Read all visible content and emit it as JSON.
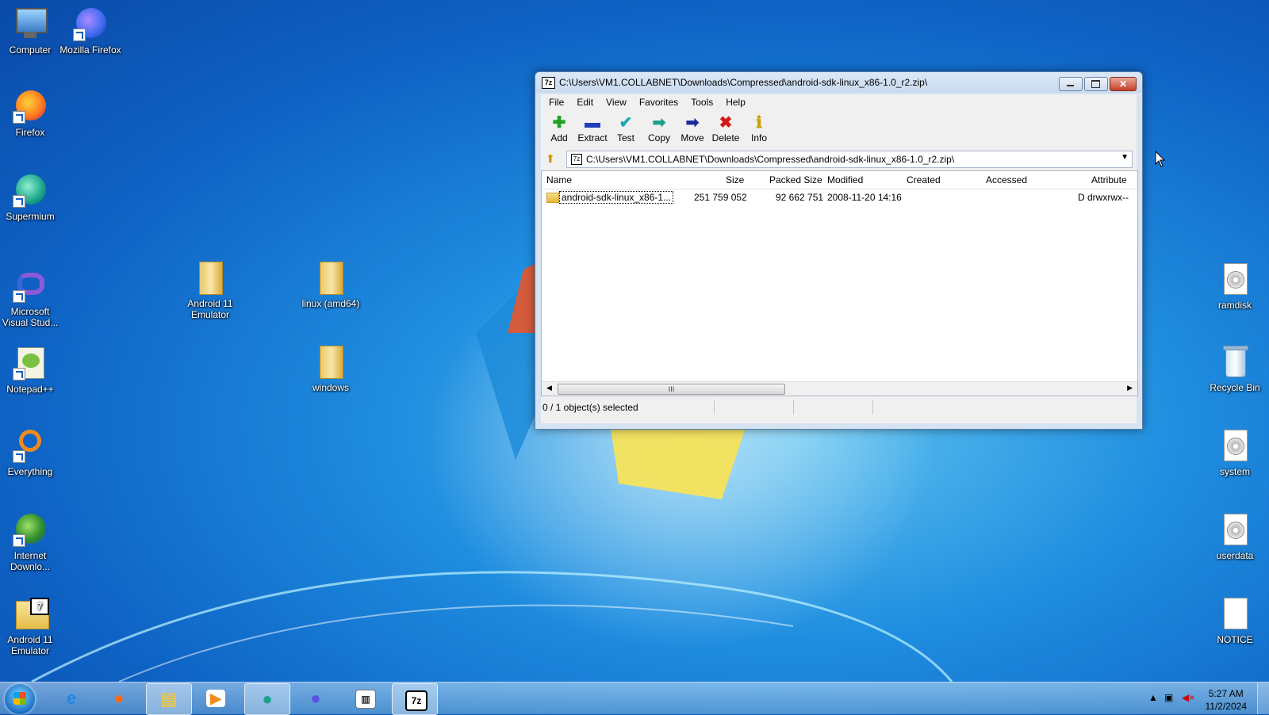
{
  "desktop": {
    "left_icons": [
      {
        "label": "Computer",
        "icon": "computer-icon"
      },
      {
        "label": "Mozilla Firefox",
        "icon": "firefox-icon"
      },
      {
        "label": "Firefox",
        "icon": "firefox-icon"
      },
      {
        "label": "Supermium",
        "icon": "supermium-icon"
      },
      {
        "label": "Microsoft Visual Stud...",
        "icon": "visual-studio-icon"
      },
      {
        "label": "Notepad++",
        "icon": "notepadpp-icon"
      },
      {
        "label": "Everything",
        "icon": "everything-icon"
      },
      {
        "label": "Internet Downlo...",
        "icon": "idm-icon"
      },
      {
        "label": "Android 11 Emulator",
        "icon": "7zip-archive-icon"
      }
    ],
    "mid_icons": [
      {
        "label": "Android 11 Emulator",
        "icon": "folder-icon"
      },
      {
        "label": "linux (amd64)",
        "icon": "folder-icon"
      },
      {
        "label": "windows",
        "icon": "folder-icon"
      }
    ],
    "right_icons": [
      {
        "label": "ramdisk",
        "icon": "disk-image-icon"
      },
      {
        "label": "Recycle Bin",
        "icon": "recycle-bin-icon"
      },
      {
        "label": "system",
        "icon": "disk-image-icon"
      },
      {
        "label": "userdata",
        "icon": "disk-image-icon"
      },
      {
        "label": "NOTICE",
        "icon": "text-file-icon"
      }
    ]
  },
  "window": {
    "title": "C:\\Users\\VM1.COLLABNET\\Downloads\\Compressed\\android-sdk-linux_x86-1.0_r2.zip\\",
    "app_icon": "7z",
    "close_glyph": "✕",
    "menu": [
      "File",
      "Edit",
      "View",
      "Favorites",
      "Tools",
      "Help"
    ],
    "toolbar": [
      {
        "label": "Add",
        "icon": "add-icon",
        "glyph": "✚",
        "color": "#1fa11f"
      },
      {
        "label": "Extract",
        "icon": "extract-icon",
        "glyph": "▬",
        "color": "#1f3fbf"
      },
      {
        "label": "Test",
        "icon": "test-icon",
        "glyph": "✔",
        "color": "#17a8b8"
      },
      {
        "label": "Copy",
        "icon": "copy-icon",
        "glyph": "➡",
        "color": "#17a088"
      },
      {
        "label": "Move",
        "icon": "move-icon",
        "glyph": "➡",
        "color": "#1a2a9a"
      },
      {
        "label": "Delete",
        "icon": "delete-icon",
        "glyph": "✖",
        "color": "#d01a1a"
      },
      {
        "label": "Info",
        "icon": "info-icon",
        "glyph": "ℹ",
        "color": "#c8a000"
      }
    ],
    "address": "C:\\Users\\VM1.COLLABNET\\Downloads\\Compressed\\android-sdk-linux_x86-1.0_r2.zip\\",
    "columns": [
      "Name",
      "Size",
      "Packed Size",
      "Modified",
      "Created",
      "Accessed",
      "Attribute"
    ],
    "rows": [
      {
        "name": "android-sdk-linux_x86-1...",
        "size": "251 759 052",
        "packed": "92 662 751",
        "modified": "2008-11-20 14:16",
        "created": "",
        "accessed": "",
        "attr": "D drwxrwx--"
      }
    ],
    "scroll_thumb": "III",
    "status": "0 / 1 object(s) selected"
  },
  "taskbar": {
    "apps": [
      {
        "name": "ie-icon",
        "glyph": "e",
        "color": "#1e88e5"
      },
      {
        "name": "firefox-icon",
        "glyph": "●",
        "color": "#ff6a13"
      },
      {
        "name": "explorer-icon",
        "glyph": "▤",
        "color": "#e8c64a"
      },
      {
        "name": "media-player-icon",
        "glyph": "▶",
        "color": "#f28c1c"
      },
      {
        "name": "supermium-icon",
        "glyph": "●",
        "color": "#18a38a"
      },
      {
        "name": "firefox-dev-icon",
        "glyph": "●",
        "color": "#5b4ee0"
      },
      {
        "name": "notepad-icon",
        "glyph": "▥",
        "color": "#ffffff"
      },
      {
        "name": "7zip-icon",
        "glyph": "7z",
        "color": "#ffffff"
      }
    ],
    "time": "5:27 AM",
    "date": "11/2/2024"
  }
}
